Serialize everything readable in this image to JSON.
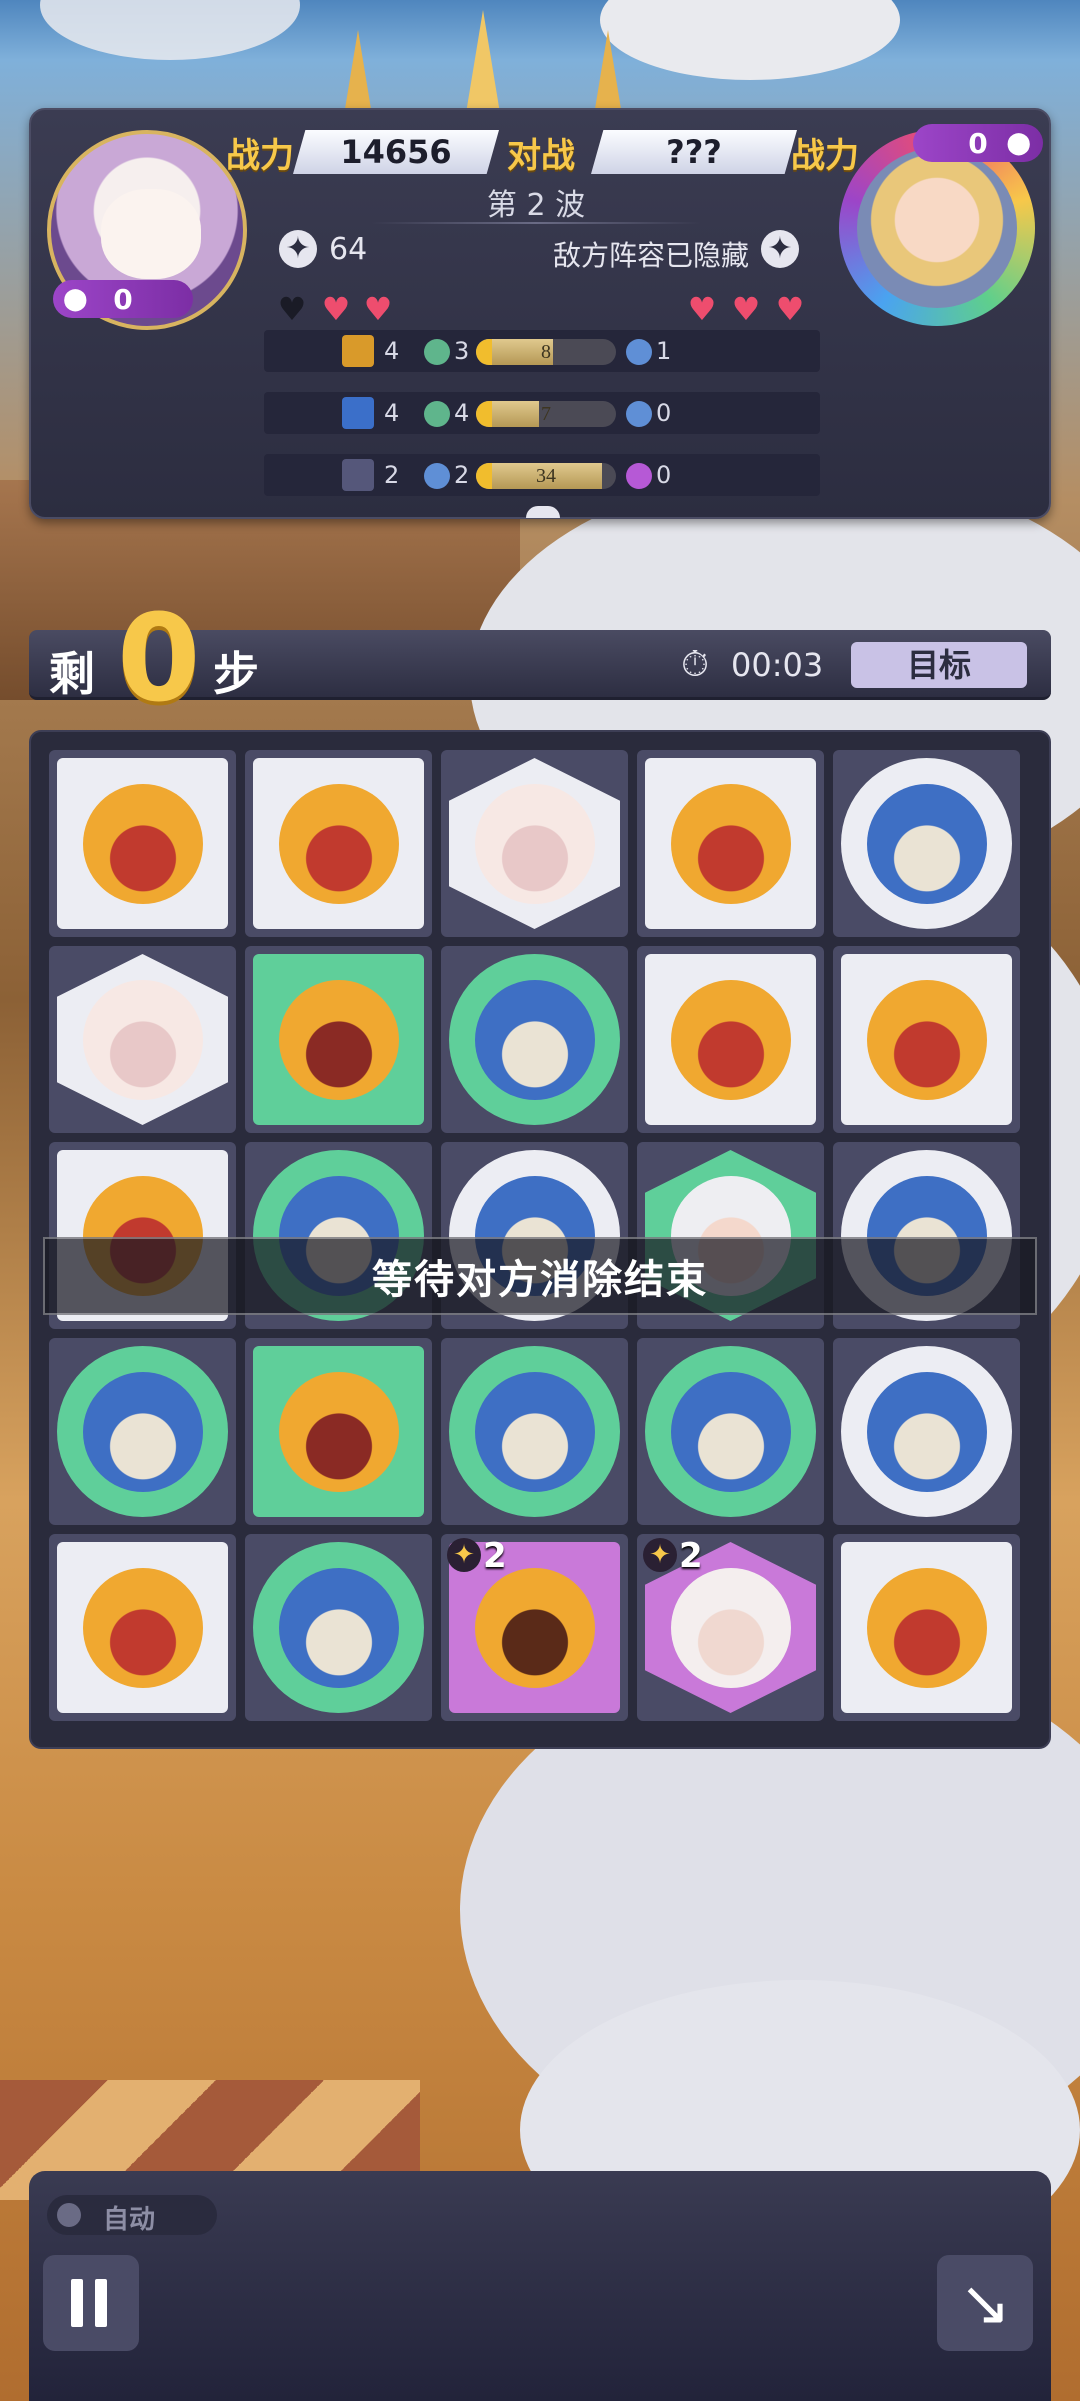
{
  "top": {
    "power_label_left": "战力",
    "power_value": "14656",
    "versus_label": "对战",
    "enemy_power_value": "???",
    "power_label_right": "战力",
    "wave": "第 2 波",
    "player_score": "64",
    "enemy_lineup_hidden": "敌方阵容已隐藏",
    "player_count": "0",
    "enemy_count": "0",
    "player_hearts": 2,
    "player_hearts_total": 3,
    "enemy_hearts": 3
  },
  "lineups": [
    {
      "level": "4",
      "left_count": "3",
      "bar_text": "8",
      "bar_fill": 0.55,
      "right_count": "1",
      "left_orb": "#5fb58c",
      "right_orb": "#5f8fd6",
      "mini": "#d99a2a"
    },
    {
      "level": "4",
      "left_count": "4",
      "bar_text": "7",
      "bar_fill": 0.45,
      "right_count": "0",
      "left_orb": "#5fb58c",
      "right_orb": "#5f8fd6",
      "mini": "#3b6fc9"
    },
    {
      "level": "2",
      "left_count": "2",
      "bar_text": "34",
      "bar_fill": 0.9,
      "right_count": "0",
      "left_orb": "#5f8fd6",
      "right_orb": "#b659d6",
      "mini": "#55577a"
    }
  ],
  "steps": {
    "prefix": "剩",
    "count": "0",
    "suffix": "步",
    "timer": "00:03",
    "goal_button": "目标"
  },
  "banner": "等待对方消除结束",
  "board": [
    [
      "yellow-sq",
      "yellow-sq",
      "white-hex",
      "yellow-sq",
      "blue-circle"
    ],
    [
      "white-hex",
      "yellow-green",
      "blue-green",
      "yellow-sq",
      "yellow-sq"
    ],
    [
      "yellow-sq",
      "blue-green",
      "blue-circle",
      "green-hex",
      "blue-circle"
    ],
    [
      "blue-green",
      "yellow-green",
      "blue-green",
      "blue-green",
      "blue-circle"
    ],
    [
      "yellow-sq",
      "blue-green",
      "yellow-purple",
      "white-purple",
      "yellow-sq"
    ]
  ],
  "special_tiles": [
    {
      "row": 4,
      "col": 2,
      "level": "2"
    },
    {
      "row": 4,
      "col": 3,
      "level": "2"
    }
  ],
  "bottom": {
    "auto_label": "自动",
    "pause": "pause",
    "exit": "exit"
  },
  "colors": {
    "accent_yellow": "#f7c84a",
    "panel_dark": "#2c2d40",
    "heart_pink": "#ee4d6e",
    "goal_bg": "#c9c2e6"
  }
}
